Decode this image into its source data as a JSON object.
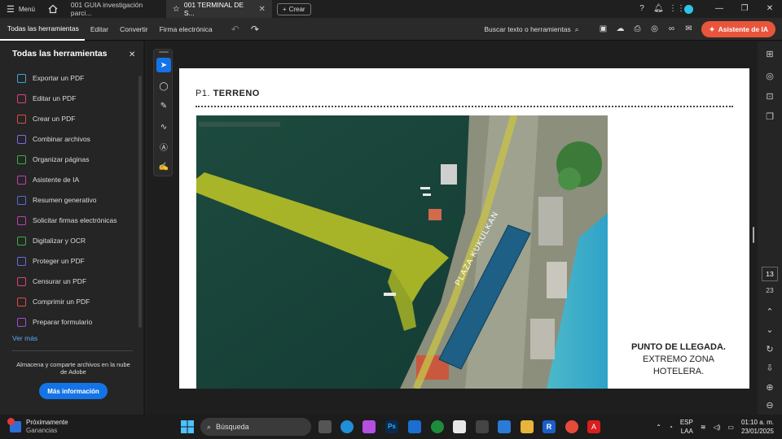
{
  "tabbar": {
    "menu_label": "Menú",
    "tabs": [
      {
        "label": "001 GUIA investigación parci..."
      },
      {
        "label": "001 TERMINAL DE S...",
        "active": true
      }
    ],
    "new_label": "Crear"
  },
  "toolbar": {
    "items": [
      "Todas las herramientas",
      "Editar",
      "Convertir",
      "Firma electrónica"
    ],
    "search_label": "Buscar texto o herramientas",
    "ai_label": "Asistente de IA"
  },
  "leftpanel": {
    "title": "Todas las herramientas",
    "items": [
      {
        "label": "Exportar un PDF",
        "color": "#3aa6d6"
      },
      {
        "label": "Editar un PDF",
        "color": "#e2407c"
      },
      {
        "label": "Crear un PDF",
        "color": "#e24848"
      },
      {
        "label": "Combinar archivos",
        "color": "#7a6be6"
      },
      {
        "label": "Organizar páginas",
        "color": "#3cb043"
      },
      {
        "label": "Asistente de IA",
        "color": "#c43bb8"
      },
      {
        "label": "Resumen generativo",
        "color": "#5a6be0"
      },
      {
        "label": "Solicitar firmas electrónicas",
        "color": "#c43bb8"
      },
      {
        "label": "Digitalizar y OCR",
        "color": "#3cb043"
      },
      {
        "label": "Proteger un PDF",
        "color": "#6a6be0"
      },
      {
        "label": "Censurar un PDF",
        "color": "#e2407c"
      },
      {
        "label": "Comprimir un PDF",
        "color": "#e24848"
      },
      {
        "label": "Preparar formulario",
        "color": "#a44bd6"
      }
    ],
    "more_link": "Ver más",
    "note": "Almacena y comparte archivos en la nube de Adobe",
    "more_button": "Más información"
  },
  "document": {
    "title_prefix": "P1.",
    "title_main": "TERRENO",
    "map_label": "PLAZA KUKULKAN",
    "caption_line1": "PUNTO DE LLEGADA.",
    "caption_line2": "EXTREMO ZONA",
    "caption_line3": "HOTELERA."
  },
  "pagination": {
    "current": "13",
    "total": "23"
  },
  "taskbar": {
    "weather_title": "Próximamente",
    "weather_sub": "Ganancias",
    "search_label": "Búsqueda",
    "lang1": "ESP",
    "lang2": "LAA",
    "time": "01:10 a. m.",
    "date": "23/01/2025"
  }
}
